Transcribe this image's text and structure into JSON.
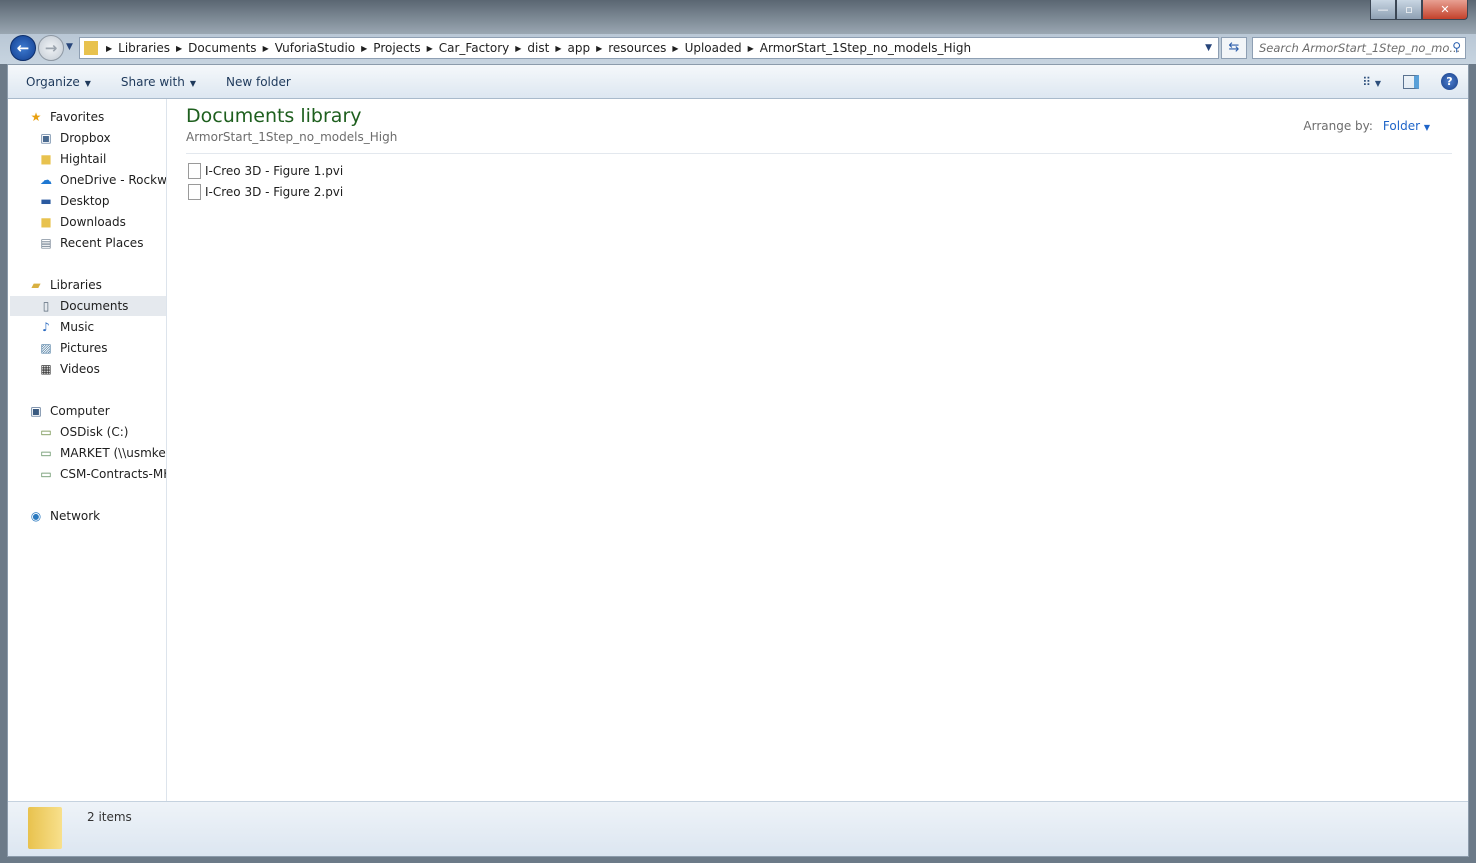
{
  "window": {
    "minimize": "—",
    "maximize": "▫",
    "close": "✕"
  },
  "address": {
    "crumbs": [
      "Libraries",
      "Documents",
      "VuforiaStudio",
      "Projects",
      "Car_Factory",
      "dist",
      "app",
      "resources",
      "Uploaded",
      "ArmorStart_1Step_no_models_High"
    ]
  },
  "search": {
    "placeholder": "Search ArmorStart_1Step_no_mo..."
  },
  "toolbar": {
    "organize": "Organize",
    "share_with": "Share with",
    "new_folder": "New folder"
  },
  "sidebar": {
    "items": [
      {
        "label": "Favorites",
        "icon": "star-icon",
        "level": 0
      },
      {
        "label": "Dropbox",
        "icon": "dropbox-icon",
        "level": 1
      },
      {
        "label": "Hightail",
        "icon": "folder-icon",
        "level": 1
      },
      {
        "label": "OneDrive - Rockwell",
        "icon": "cloud-icon",
        "level": 1
      },
      {
        "label": "Desktop",
        "icon": "desktop-icon",
        "level": 1
      },
      {
        "label": "Downloads",
        "icon": "downloads-icon",
        "level": 1
      },
      {
        "label": "Recent Places",
        "icon": "recent-icon",
        "level": 1
      },
      {
        "label": "Libraries",
        "icon": "libraries-icon",
        "level": 0
      },
      {
        "label": "Documents",
        "icon": "document-icon",
        "level": 1,
        "selected": true
      },
      {
        "label": "Music",
        "icon": "music-icon",
        "level": 1
      },
      {
        "label": "Pictures",
        "icon": "pictures-icon",
        "level": 1
      },
      {
        "label": "Videos",
        "icon": "videos-icon",
        "level": 1
      },
      {
        "label": "Computer",
        "icon": "computer-icon",
        "level": 0
      },
      {
        "label": "OSDisk (C:)",
        "icon": "drive-icon",
        "level": 1
      },
      {
        "label": "MARKET (\\\\usmkevf",
        "icon": "network-drive-icon",
        "level": 1
      },
      {
        "label": "CSM-Contracts-MKE",
        "icon": "network-drive-icon",
        "level": 1
      },
      {
        "label": "Network",
        "icon": "network-icon",
        "level": 0
      }
    ]
  },
  "content": {
    "title": "Documents library",
    "subtitle": "ArmorStart_1Step_no_models_High",
    "arrange_label": "Arrange by:",
    "arrange_value": "Folder",
    "files": [
      "I-Creo 3D - Figure 1.pvi",
      "I-Creo 3D - Figure 2.pvi"
    ]
  },
  "status": {
    "count": "2 items"
  }
}
